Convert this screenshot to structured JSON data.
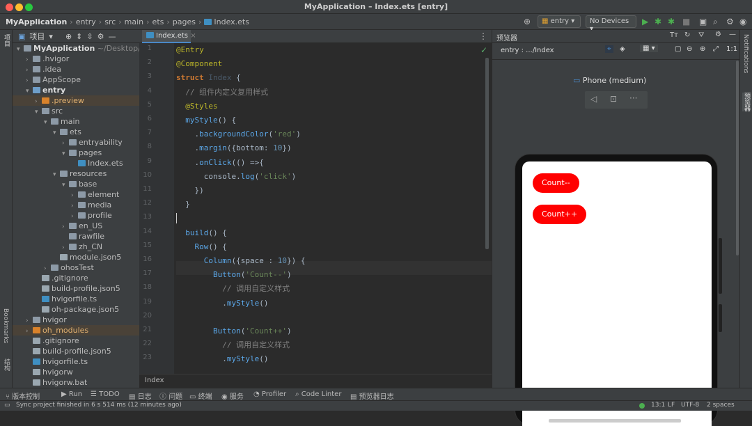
{
  "window": {
    "title": "MyApplication – Index.ets [entry]"
  },
  "breadcrumb": [
    "MyApplication",
    "entry",
    "src",
    "main",
    "ets",
    "pages",
    "Index.ets"
  ],
  "run_config": {
    "module": "entry",
    "device": "No Devices"
  },
  "project_panel": {
    "title": "项目",
    "tree": [
      {
        "label": "MyApplication",
        "suffix": "~/Desktop/MyA",
        "depth": 0,
        "arrow": "▾",
        "icon": "folder",
        "bold": true
      },
      {
        "label": ".hvigor",
        "depth": 1,
        "arrow": "›",
        "icon": "folder"
      },
      {
        "label": ".idea",
        "depth": 1,
        "arrow": "›",
        "icon": "folder"
      },
      {
        "label": "AppScope",
        "depth": 1,
        "arrow": "›",
        "icon": "folder"
      },
      {
        "label": "entry",
        "depth": 1,
        "arrow": "▾",
        "icon": "module",
        "bold": true
      },
      {
        "label": ".preview",
        "depth": 2,
        "arrow": "›",
        "icon": "folder-orange",
        "highlight": true
      },
      {
        "label": "src",
        "depth": 2,
        "arrow": "▾",
        "icon": "folder"
      },
      {
        "label": "main",
        "depth": 3,
        "arrow": "▾",
        "icon": "folder"
      },
      {
        "label": "ets",
        "depth": 4,
        "arrow": "▾",
        "icon": "folder"
      },
      {
        "label": "entryability",
        "depth": 5,
        "arrow": "›",
        "icon": "folder"
      },
      {
        "label": "pages",
        "depth": 5,
        "arrow": "▾",
        "icon": "folder"
      },
      {
        "label": "Index.ets",
        "depth": 6,
        "arrow": "",
        "icon": "file-ets"
      },
      {
        "label": "resources",
        "depth": 4,
        "arrow": "▾",
        "icon": "folder"
      },
      {
        "label": "base",
        "depth": 5,
        "arrow": "▾",
        "icon": "folder"
      },
      {
        "label": "element",
        "depth": 6,
        "arrow": "›",
        "icon": "folder"
      },
      {
        "label": "media",
        "depth": 6,
        "arrow": "›",
        "icon": "folder"
      },
      {
        "label": "profile",
        "depth": 6,
        "arrow": "›",
        "icon": "folder"
      },
      {
        "label": "en_US",
        "depth": 5,
        "arrow": "›",
        "icon": "folder"
      },
      {
        "label": "rawfile",
        "depth": 5,
        "arrow": "",
        "icon": "folder"
      },
      {
        "label": "zh_CN",
        "depth": 5,
        "arrow": "›",
        "icon": "folder"
      },
      {
        "label": "module.json5",
        "depth": 4,
        "arrow": "",
        "icon": "file-json"
      },
      {
        "label": "ohosTest",
        "depth": 3,
        "arrow": "›",
        "icon": "folder"
      },
      {
        "label": ".gitignore",
        "depth": 2,
        "arrow": "",
        "icon": "file"
      },
      {
        "label": "build-profile.json5",
        "depth": 2,
        "arrow": "",
        "icon": "file-json"
      },
      {
        "label": "hvigorfile.ts",
        "depth": 2,
        "arrow": "",
        "icon": "file-ts"
      },
      {
        "label": "oh-package.json5",
        "depth": 2,
        "arrow": "",
        "icon": "file-json"
      },
      {
        "label": "hvigor",
        "depth": 1,
        "arrow": "›",
        "icon": "folder"
      },
      {
        "label": "oh_modules",
        "depth": 1,
        "arrow": "›",
        "icon": "folder-orange",
        "highlight": true
      },
      {
        "label": ".gitignore",
        "depth": 1,
        "arrow": "",
        "icon": "file"
      },
      {
        "label": "build-profile.json5",
        "depth": 1,
        "arrow": "",
        "icon": "file-json"
      },
      {
        "label": "hvigorfile.ts",
        "depth": 1,
        "arrow": "",
        "icon": "file-ts"
      },
      {
        "label": "hvigorw",
        "depth": 1,
        "arrow": "",
        "icon": "file"
      },
      {
        "label": "hvigorw.bat",
        "depth": 1,
        "arrow": "",
        "icon": "file"
      }
    ]
  },
  "editor": {
    "tab_label": "Index.ets",
    "footer_breadcrumb": "Index",
    "lines": [
      [
        [
          "ann",
          "@Entry"
        ]
      ],
      [
        [
          "ann",
          "@Component"
        ]
      ],
      [
        [
          "kw",
          "struct "
        ],
        [
          "cls",
          "Index "
        ],
        [
          "pl",
          "{"
        ]
      ],
      [
        [
          "cm",
          "  // 组件内定义复用样式"
        ]
      ],
      [
        [
          "ann",
          "  @Styles"
        ]
      ],
      [
        [
          "fn",
          "  myStyle"
        ],
        [
          "pl",
          "() {"
        ]
      ],
      [
        [
          "pl",
          "    ."
        ],
        [
          "fn",
          "backgroundColor"
        ],
        [
          "pl",
          "("
        ],
        [
          "st",
          "'red'"
        ],
        [
          "pl",
          ")"
        ]
      ],
      [
        [
          "pl",
          "    ."
        ],
        [
          "fn",
          "margin"
        ],
        [
          "pl",
          "({"
        ],
        [
          "pl",
          "bottom: "
        ],
        [
          "nm",
          "10"
        ],
        [
          "pl",
          "})"
        ]
      ],
      [
        [
          "pl",
          "    ."
        ],
        [
          "fn",
          "onClick"
        ],
        [
          "pl",
          "(() =>{"
        ]
      ],
      [
        [
          "pl",
          "      console."
        ],
        [
          "fn",
          "log"
        ],
        [
          "pl",
          "("
        ],
        [
          "st",
          "'click'"
        ],
        [
          "pl",
          ")"
        ]
      ],
      [
        [
          "pl",
          "    })"
        ]
      ],
      [
        [
          "pl",
          "  }"
        ]
      ],
      [
        [
          "pl",
          ""
        ]
      ],
      [
        [
          "fn",
          "  build"
        ],
        [
          "pl",
          "() {"
        ]
      ],
      [
        [
          "fn",
          "    Row"
        ],
        [
          "pl",
          "() {"
        ]
      ],
      [
        [
          "fn",
          "      Column"
        ],
        [
          "pl",
          "({"
        ],
        [
          "pl",
          "space : "
        ],
        [
          "nm",
          "10"
        ],
        [
          "pl",
          "}) {"
        ]
      ],
      [
        [
          "fn",
          "        Button"
        ],
        [
          "pl",
          "("
        ],
        [
          "st",
          "'Count--'"
        ],
        [
          "pl",
          ")"
        ]
      ],
      [
        [
          "cm",
          "          // 调用自定义样式"
        ]
      ],
      [
        [
          "pl",
          "          ."
        ],
        [
          "fn",
          "myStyle"
        ],
        [
          "pl",
          "()"
        ]
      ],
      [
        [
          "pl",
          ""
        ]
      ],
      [
        [
          "fn",
          "        Button"
        ],
        [
          "pl",
          "("
        ],
        [
          "st",
          "'Count++'"
        ],
        [
          "pl",
          ")"
        ]
      ],
      [
        [
          "cm",
          "          // 调用自定义样式"
        ]
      ],
      [
        [
          "pl",
          "          ."
        ],
        [
          "fn",
          "myStyle"
        ],
        [
          "pl",
          "()"
        ]
      ]
    ]
  },
  "preview_panel": {
    "title": "预览器",
    "path": "entry : .../Index",
    "device_label": "Phone (medium)",
    "buttons": [
      "Count--",
      "Count++"
    ]
  },
  "left_strip": {
    "project": "项目",
    "bookmarks": "Bookmarks",
    "structure": "结构"
  },
  "right_strip": {
    "notifications": "Notifications",
    "previewer": "预览器"
  },
  "bottom_tools": [
    "版本控制",
    "Run",
    "TODO",
    "日志",
    "问题",
    "终端",
    "服务",
    "Profiler",
    "Code Linter",
    "预览器日志"
  ],
  "status": {
    "message": "Sync project finished in 6 s 514 ms (12 minutes ago)",
    "position": "13:1",
    "line_sep": "LF",
    "encoding": "UTF-8",
    "indent": "2 spaces"
  },
  "colors": {
    "accent": "#4a88c7",
    "button_red": "#ff0000",
    "run_green": "#4caf50"
  }
}
